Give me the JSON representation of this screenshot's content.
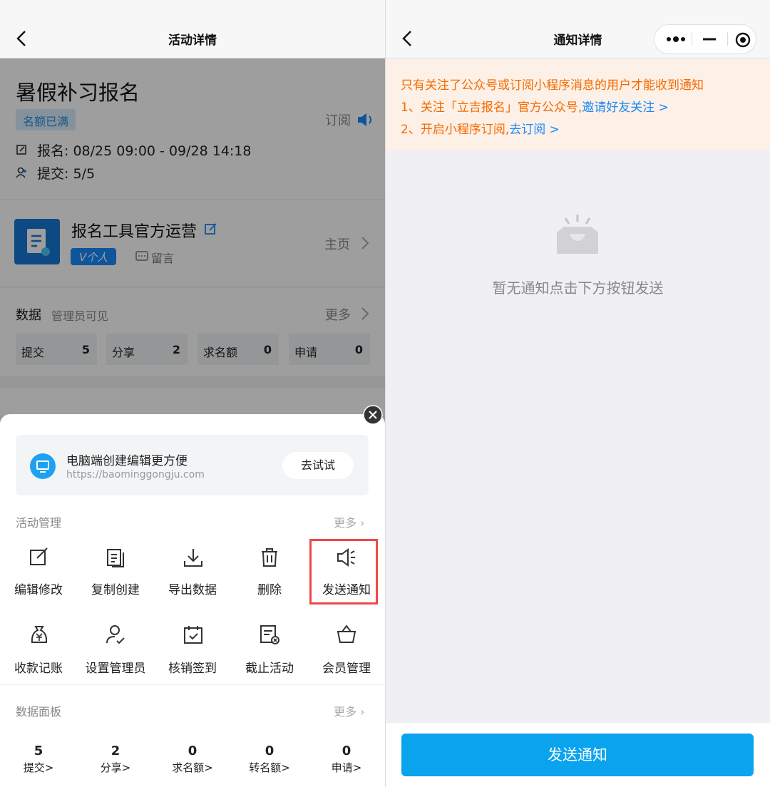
{
  "left": {
    "nav_title": "活动详情",
    "event": {
      "title": "暑假补习报名",
      "badge": "名额已满",
      "subscribe": "订阅",
      "signup_label": "报名:",
      "signup_time": "08/25 09:00 - 09/28 14:18",
      "submit_label": "提交:",
      "submit_value": "5/5"
    },
    "organizer": {
      "name": "报名工具官方运营",
      "badge": "V个人",
      "message": "留言",
      "homepage": "主页"
    },
    "data_section": {
      "title": "数据",
      "subtitle": "管理员可见",
      "more": "更多",
      "stats": [
        {
          "label": "提交",
          "value": "5"
        },
        {
          "label": "分享",
          "value": "2"
        },
        {
          "label": "求名额",
          "value": "0"
        },
        {
          "label": "申请",
          "value": "0"
        }
      ]
    },
    "sheet": {
      "promo_title": "电脑端创建编辑更方便",
      "promo_url": "https://baominggongju.com",
      "promo_button": "去试试",
      "manage_title": "活动管理",
      "manage_more": "更多",
      "actions_row1": [
        "编辑修改",
        "复制创建",
        "导出数据",
        "删除",
        "发送通知"
      ],
      "actions_row2": [
        "收款记账",
        "设置管理员",
        "核销签到",
        "截止活动",
        "会员管理"
      ],
      "panel_title": "数据面板",
      "panel_more": "更多",
      "panel_stats": [
        {
          "value": "5",
          "label": "提交>"
        },
        {
          "value": "2",
          "label": "分享>"
        },
        {
          "value": "0",
          "label": "求名额>"
        },
        {
          "value": "0",
          "label": "转名额>"
        },
        {
          "value": "0",
          "label": "申请>"
        }
      ]
    }
  },
  "right": {
    "nav_title": "通知详情",
    "notice_line1": "只有关注了公众号或订阅小程序消息的用户才能收到通知",
    "notice_line2": "1、关注「立吉报名」官方公众号,",
    "notice_link2": "邀请好友关注 >",
    "notice_line3": "2、开启小程序订阅,",
    "notice_link3": "去订阅 >",
    "empty_text": "暂无通知点击下方按钮发送",
    "send_button": "发送通知"
  },
  "colors": {
    "accent": "#0aa3ee",
    "orange": "#f56a00",
    "highlight": "#f04848"
  }
}
